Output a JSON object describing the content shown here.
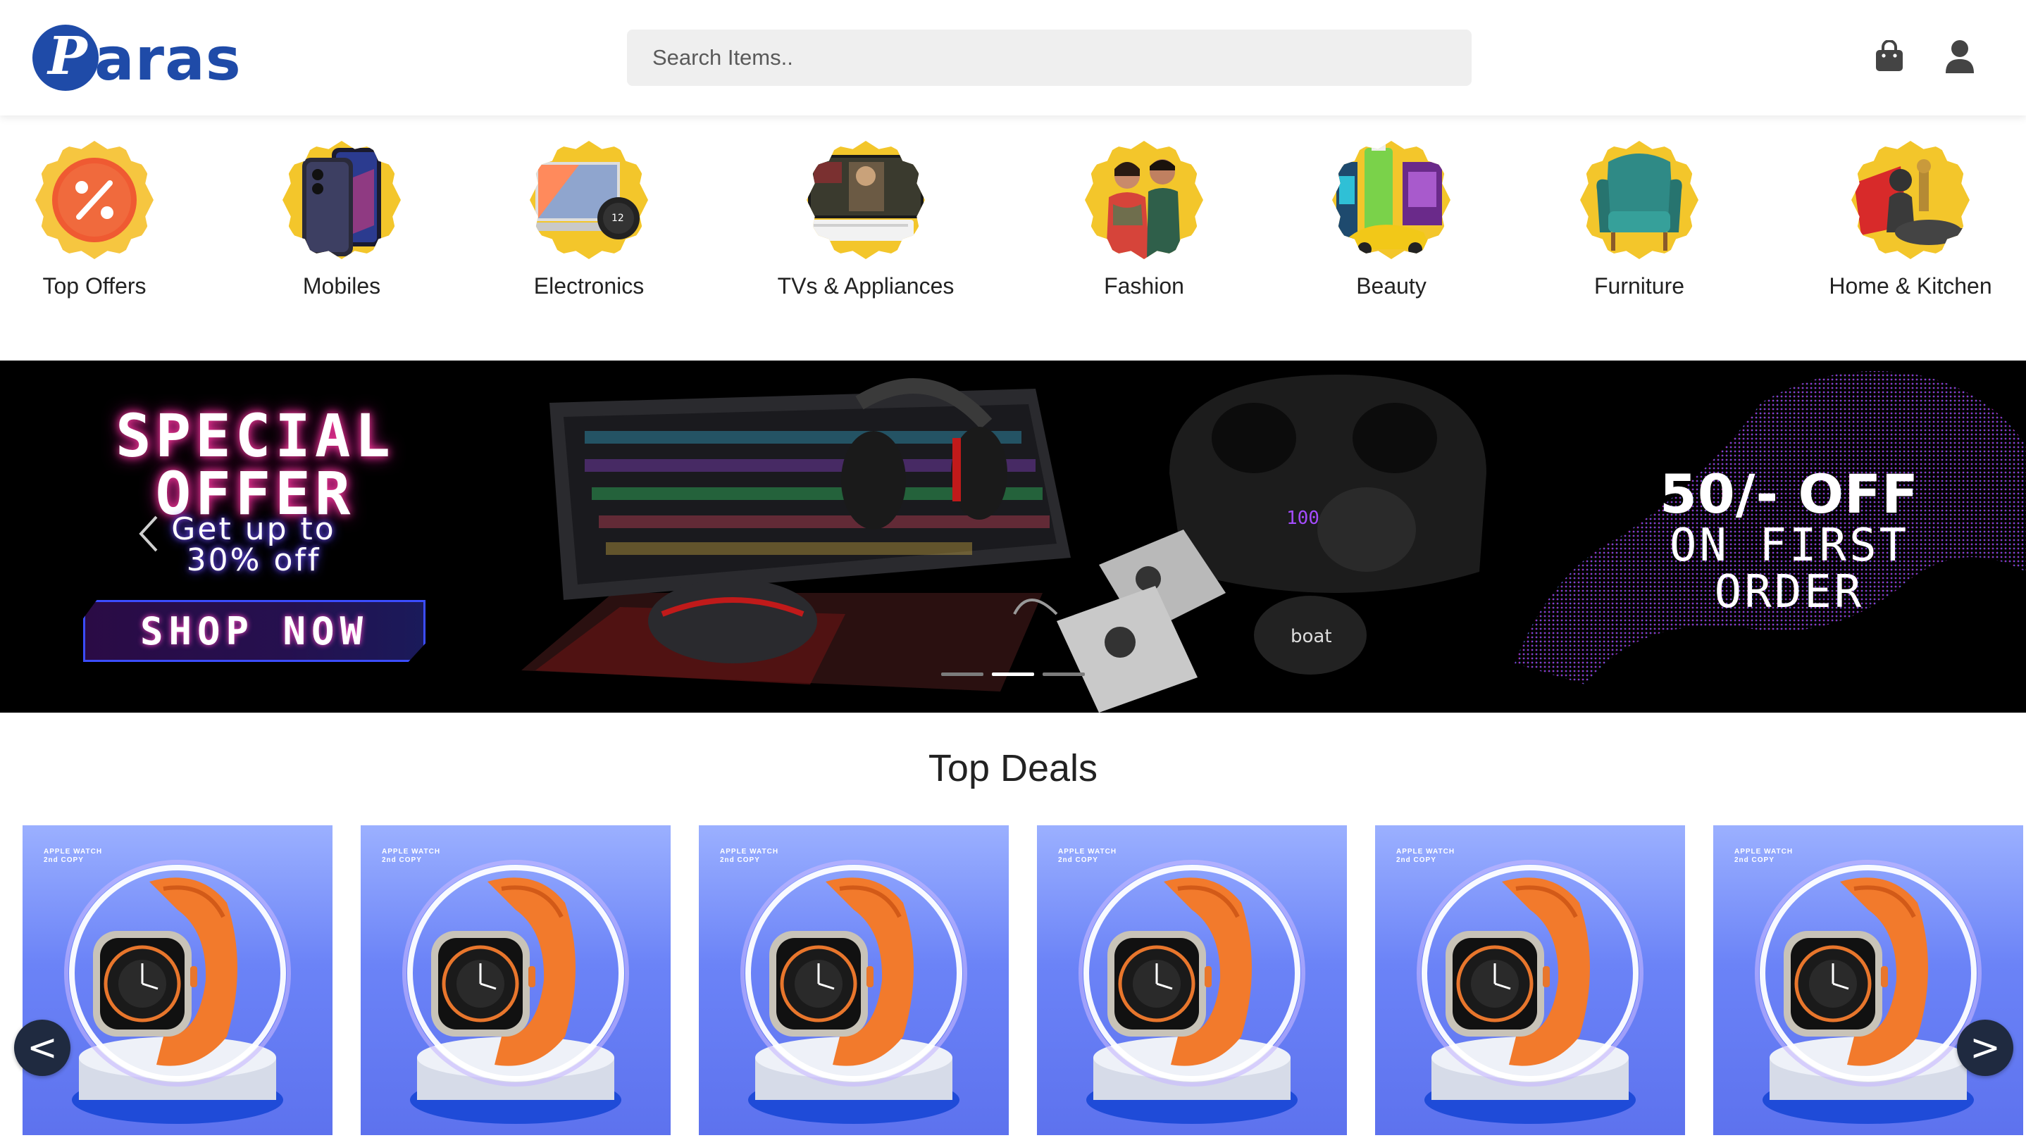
{
  "header": {
    "logo_letter": "P",
    "logo_text": "aras",
    "search_placeholder": "Search Items..",
    "cart_icon": "shopping-bag-icon",
    "profile_icon": "user-icon"
  },
  "categories": [
    {
      "label": "Top Offers",
      "icon": "percent-badge-icon"
    },
    {
      "label": "Mobiles",
      "icon": "phone-icon"
    },
    {
      "label": "Electronics",
      "icon": "laptop-icon"
    },
    {
      "label": "TVs & Appliances",
      "icon": "tv-icon"
    },
    {
      "label": "Fashion",
      "icon": "fashion-couple-icon"
    },
    {
      "label": "Beauty",
      "icon": "beauty-products-icon"
    },
    {
      "label": "Furniture",
      "icon": "armchair-icon"
    },
    {
      "label": "Home & Kitchen",
      "icon": "kitchen-items-icon"
    }
  ],
  "banner": {
    "title_line1": "SPECIAL",
    "title_line2": "OFFER",
    "sub_line1": "Get up to",
    "sub_line2": "30% off",
    "button": "SHOP NOW",
    "promo_line1": "50/- OFF",
    "promo_line2": "ON FIRST",
    "promo_line3": "ORDER",
    "slides": 3,
    "active_slide": 2
  },
  "deals": {
    "title": "Top Deals",
    "prev": "<",
    "next": ">",
    "items": [
      {
        "tag_line1": "APPLE WATCH",
        "tag_line2": "2nd COPY"
      },
      {
        "tag_line1": "APPLE WATCH",
        "tag_line2": "2nd COPY"
      },
      {
        "tag_line1": "APPLE WATCH",
        "tag_line2": "2nd COPY"
      },
      {
        "tag_line1": "APPLE WATCH",
        "tag_line2": "2nd COPY"
      },
      {
        "tag_line1": "APPLE WATCH",
        "tag_line2": "2nd COPY"
      },
      {
        "tag_line1": "APPLE WATCH",
        "tag_line2": "2nd COPY"
      }
    ]
  },
  "colors": {
    "brand": "#1f4ba8",
    "category_badge": "#f3c62b",
    "banner_bg": "#000000",
    "watch_band": "#f27a2c",
    "deal_bg": "#6b83f7",
    "nav_button": "#1f2a40"
  }
}
